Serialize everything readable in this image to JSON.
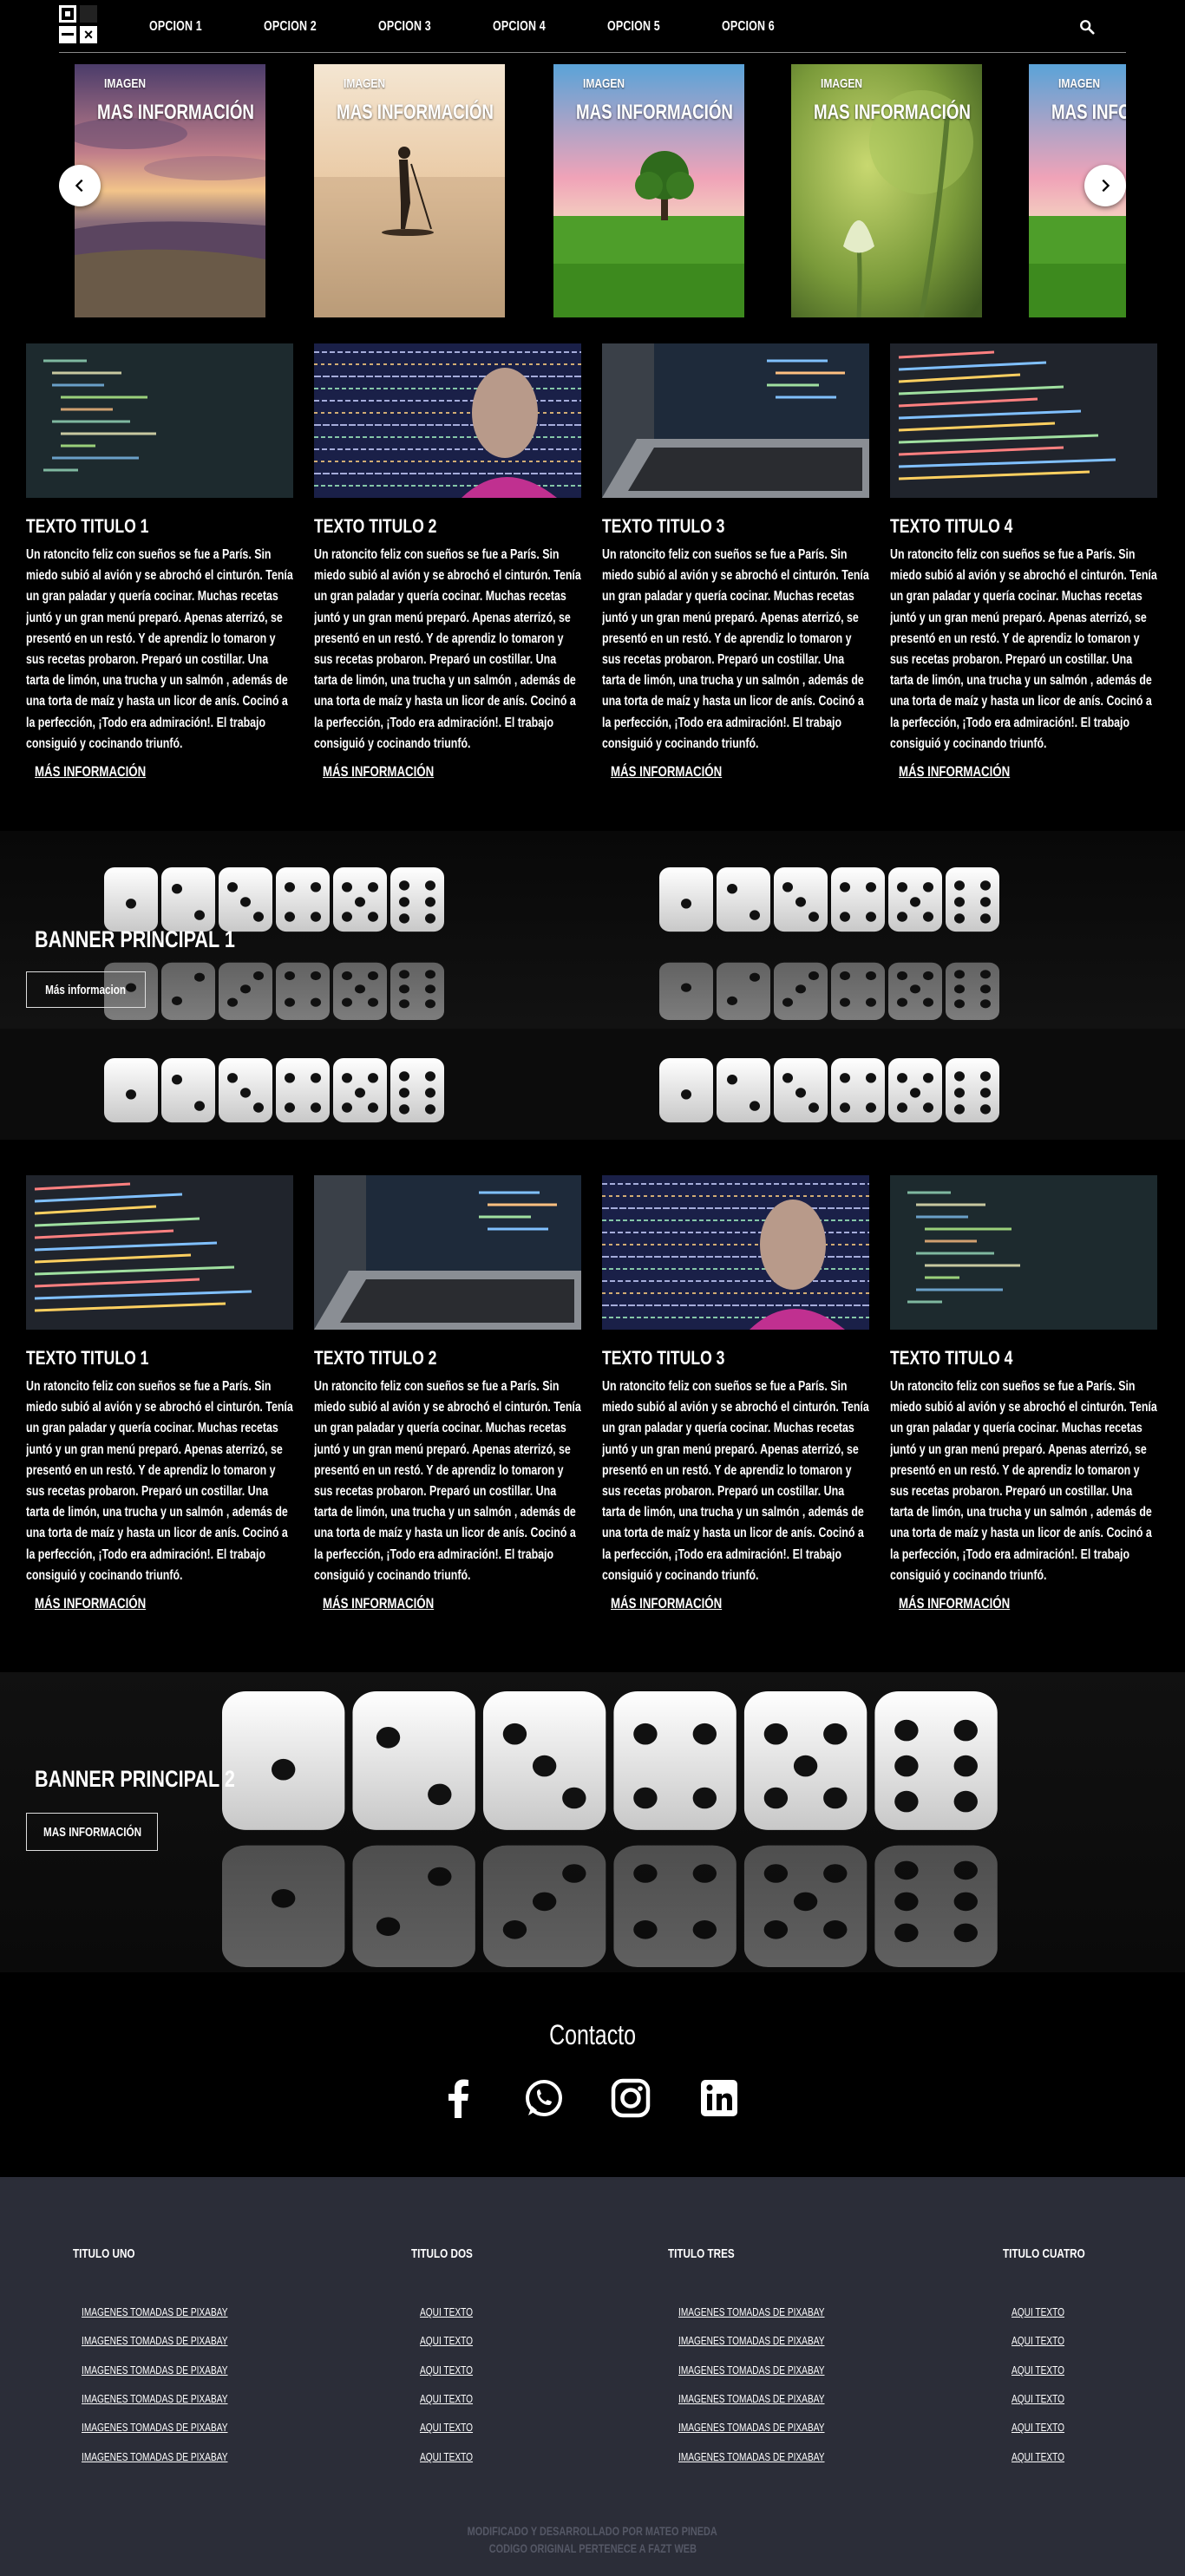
{
  "header": {
    "nav": [
      "OPCION 1",
      "OPCION 2",
      "OPCION 3",
      "OPCION 4",
      "OPCION 5",
      "OPCION 6"
    ]
  },
  "slider": {
    "slides": [
      {
        "label": "IMAGEN",
        "title": "MAS INFORMACIÓN"
      },
      {
        "label": "IMAGEN",
        "title": "MAS INFORMACIÓN"
      },
      {
        "label": "IMAGEN",
        "title": "MAS INFORMACIÓN"
      },
      {
        "label": "IMAGEN",
        "title": "MAS INFORMACIÓN"
      },
      {
        "label": "IMAGEN",
        "title": "MAS INFORMACIÓN"
      }
    ]
  },
  "cards1": [
    {
      "title": "TEXTO TITULO 1",
      "body": "Un ratoncito feliz con sueños se fue a París. Sin miedo subió al avión y se abrochó el cinturón. Tenía un gran paladar y quería cocinar. Muchas recetas juntó y un gran menú preparó. Apenas aterrizó, se presentó en un restó. Y de aprendiz lo tomaron y sus recetas probaron. Preparó un costillar. Una tarta de limón, una trucha y un salmón , además de una torta de maíz y hasta un licor de anís. Cocinó a la perfección, ¡Todo era admiración!. El trabajo consiguió y cocinando triunfó.",
      "more": "MÁS INFORMACIÓN"
    },
    {
      "title": "TEXTO TITULO 2",
      "body": "Un ratoncito feliz con sueños se fue a París. Sin miedo subió al avión y se abrochó el cinturón. Tenía un gran paladar y quería cocinar. Muchas recetas juntó y un gran menú preparó. Apenas aterrizó, se presentó en un restó. Y de aprendiz lo tomaron y sus recetas probaron. Preparó un costillar. Una tarta de limón, una trucha y un salmón , además de una torta de maíz y hasta un licor de anís. Cocinó a la perfección, ¡Todo era admiración!. El trabajo consiguió y cocinando triunfó.",
      "more": "MÁS INFORMACIÓN"
    },
    {
      "title": "TEXTO TITULO 3",
      "body": "Un ratoncito feliz con sueños se fue a París. Sin miedo subió al avión y se abrochó el cinturón. Tenía un gran paladar y quería cocinar. Muchas recetas juntó y un gran menú preparó. Apenas aterrizó, se presentó en un restó. Y de aprendiz lo tomaron y sus recetas probaron. Preparó un costillar. Una tarta de limón, una trucha y un salmón , además de una torta de maíz y hasta un licor de anís. Cocinó a la perfección, ¡Todo era admiración!. El trabajo consiguió y cocinando triunfó.",
      "more": "MÁS INFORMACIÓN"
    },
    {
      "title": "TEXTO TITULO 4",
      "body": "Un ratoncito feliz con sueños se fue a París. Sin miedo subió al avión y se abrochó el cinturón. Tenía un gran paladar y quería cocinar. Muchas recetas juntó y un gran menú preparó. Apenas aterrizó, se presentó en un restó. Y de aprendiz lo tomaron y sus recetas probaron. Preparó un costillar. Una tarta de limón, una trucha y un salmón , además de una torta de maíz y hasta un licor de anís. Cocinó a la perfección, ¡Todo era admiración!. El trabajo consiguió y cocinando triunfó.",
      "more": "MÁS INFORMACIÓN"
    }
  ],
  "banner1": {
    "title": "BANNER PRINCIPAL 1",
    "button": "Más informacion"
  },
  "cards2": [
    {
      "title": "TEXTO TITULO 1",
      "body": "Un ratoncito feliz con sueños se fue a París. Sin miedo subió al avión y se abrochó el cinturón. Tenía un gran paladar y quería cocinar. Muchas recetas juntó y un gran menú preparó. Apenas aterrizó, se presentó en un restó. Y de aprendiz lo tomaron y sus recetas probaron. Preparó un costillar. Una tarta de limón, una trucha y un salmón , además de una torta de maíz y hasta un licor de anís. Cocinó a la perfección, ¡Todo era admiración!. El trabajo consiguió y cocinando triunfó.",
      "more": "MÁS INFORMACIÓN"
    },
    {
      "title": "TEXTO TITULO 2",
      "body": "Un ratoncito feliz con sueños se fue a París. Sin miedo subió al avión y se abrochó el cinturón. Tenía un gran paladar y quería cocinar. Muchas recetas juntó y un gran menú preparó. Apenas aterrizó, se presentó en un restó. Y de aprendiz lo tomaron y sus recetas probaron. Preparó un costillar. Una tarta de limón, una trucha y un salmón , además de una torta de maíz y hasta un licor de anís. Cocinó a la perfección, ¡Todo era admiración!. El trabajo consiguió y cocinando triunfó.",
      "more": "MÁS INFORMACIÓN"
    },
    {
      "title": "TEXTO TITULO 3",
      "body": "Un ratoncito feliz con sueños se fue a París. Sin miedo subió al avión y se abrochó el cinturón. Tenía un gran paladar y quería cocinar. Muchas recetas juntó y un gran menú preparó. Apenas aterrizó, se presentó en un restó. Y de aprendiz lo tomaron y sus recetas probaron. Preparó un costillar. Una tarta de limón, una trucha y un salmón , además de una torta de maíz y hasta un licor de anís. Cocinó a la perfección, ¡Todo era admiración!. El trabajo consiguió y cocinando triunfó.",
      "more": "MÁS INFORMACIÓN"
    },
    {
      "title": "TEXTO TITULO 4",
      "body": "Un ratoncito feliz con sueños se fue a París. Sin miedo subió al avión y se abrochó el cinturón. Tenía un gran paladar y quería cocinar. Muchas recetas juntó y un gran menú preparó. Apenas aterrizó, se presentó en un restó. Y de aprendiz lo tomaron y sus recetas probaron. Preparó un costillar. Una tarta de limón, una trucha y un salmón , además de una torta de maíz y hasta un licor de anís. Cocinó a la perfección, ¡Todo era admiración!. El trabajo consiguió y cocinando triunfó.",
      "more": "MÁS INFORMACIÓN"
    }
  ],
  "banner2": {
    "title": "BANNER PRINCIPAL 2",
    "button": "MAS INFORMACIÓN"
  },
  "contact": {
    "title": "Contacto",
    "icons": [
      "facebook-icon",
      "whatsapp-icon",
      "instagram-icon",
      "linkedin-icon"
    ]
  },
  "footer": {
    "columns": [
      {
        "title": "TITULO UNO",
        "items": [
          "IMAGENES TOMADAS DE PIXABAY",
          "IMAGENES TOMADAS DE PIXABAY",
          "IMAGENES TOMADAS DE PIXABAY",
          "IMAGENES TOMADAS DE PIXABAY",
          "IMAGENES TOMADAS DE PIXABAY",
          "IMAGENES TOMADAS DE PIXABAY"
        ]
      },
      {
        "title": "TITULO DOS",
        "items": [
          "AQUI TEXTO",
          "AQUI TEXTO",
          "AQUI TEXTO",
          "AQUI TEXTO",
          "AQUI TEXTO",
          "AQUI TEXTO"
        ]
      },
      {
        "title": "TITULO TRES",
        "items": [
          "IMAGENES TOMADAS DE PIXABAY",
          "IMAGENES TOMADAS DE PIXABAY",
          "IMAGENES TOMADAS DE PIXABAY",
          "IMAGENES TOMADAS DE PIXABAY",
          "IMAGENES TOMADAS DE PIXABAY",
          "IMAGENES TOMADAS DE PIXABAY"
        ]
      },
      {
        "title": "TITULO CUATRO",
        "items": [
          "AQUI TEXTO",
          "AQUI TEXTO",
          "AQUI TEXTO",
          "AQUI TEXTO",
          "AQUI TEXTO",
          "AQUI TEXTO"
        ]
      }
    ],
    "credit_line1": "MODIFICADO Y DESARROLLADO POR MATEO PINEDA",
    "credit_line2": "CODIGO ORIGINAL PERTENECE A FAZT WEB"
  }
}
